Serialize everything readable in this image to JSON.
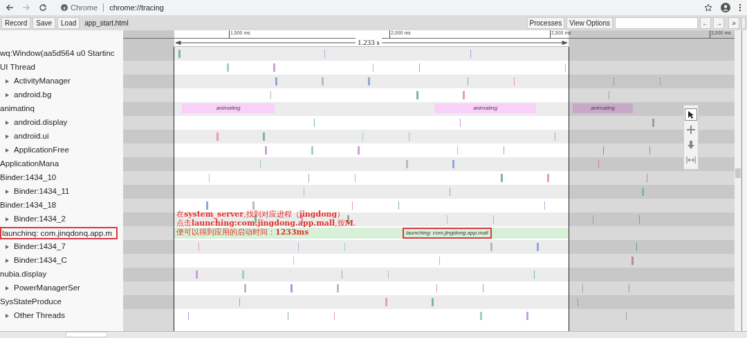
{
  "browser": {
    "site_label": "Chrome",
    "url": "chrome://tracing"
  },
  "toolbar": {
    "buttons": [
      "Record",
      "Save",
      "Load"
    ],
    "file_name": "app_start.html",
    "right_buttons": [
      "Processes",
      "View Options"
    ],
    "nav_buttons": [
      "←",
      "→",
      "»"
    ]
  },
  "ruler": {
    "ticks": [
      "1,500 ms",
      "2,000 ms",
      "2,500 ms",
      "3,000 ms"
    ],
    "range": "1.233 s"
  },
  "tracks": [
    {
      "label": "wq:Window(aa5d564 u0 Startinc",
      "kind": "process"
    },
    {
      "label": "UI Thread",
      "kind": "process"
    },
    {
      "label": "ActivityManager",
      "kind": "thread"
    },
    {
      "label": "android.bg",
      "kind": "thread"
    },
    {
      "label": "animatinq",
      "kind": "process",
      "slices": [
        {
          "label": "animating",
          "kind": "animation"
        },
        {
          "label": "animating",
          "kind": "animation"
        },
        {
          "label": "animating",
          "kind": "animation-dimmed"
        }
      ]
    },
    {
      "label": "android.display",
      "kind": "thread"
    },
    {
      "label": "android.ui",
      "kind": "thread"
    },
    {
      "label": "ApplicationFree",
      "kind": "thread"
    },
    {
      "label": "ApplicationMana",
      "kind": "process"
    },
    {
      "label": "Binder:1434_10",
      "kind": "process"
    },
    {
      "label": "Binder:1434_11",
      "kind": "thread"
    },
    {
      "label": "Binder:1434_18",
      "kind": "process"
    },
    {
      "label": "Binder:1434_2",
      "kind": "thread"
    },
    {
      "label": "launchinq: com.jinqdonq.app.m",
      "kind": "annotated",
      "slices": [
        {
          "label": "launching: com.jingdong.app.mall",
          "kind": "launch"
        }
      ]
    },
    {
      "label": "Binder:1434_7",
      "kind": "thread"
    },
    {
      "label": "Binder:1434_C",
      "kind": "thread"
    },
    {
      "label": "nubia.display",
      "kind": "process"
    },
    {
      "label": "PowerManagerSer",
      "kind": "thread"
    },
    {
      "label": "SysStateProduce",
      "kind": "process"
    },
    {
      "label": "Other Threads",
      "kind": "thread"
    }
  ],
  "annotation": [
    "在**system_server**,找到对应进程（**jingdong**）",
    "点击**launching:com.jingdong.app.mall**,按**M**.",
    "便可以得到应用的启动时间：**1233ms**"
  ],
  "tools": [
    {
      "kind": "select",
      "selected": true
    },
    {
      "kind": "pan",
      "selected": false
    },
    {
      "kind": "zoom",
      "selected": false
    },
    {
      "kind": "timing",
      "selected": false
    }
  ]
}
